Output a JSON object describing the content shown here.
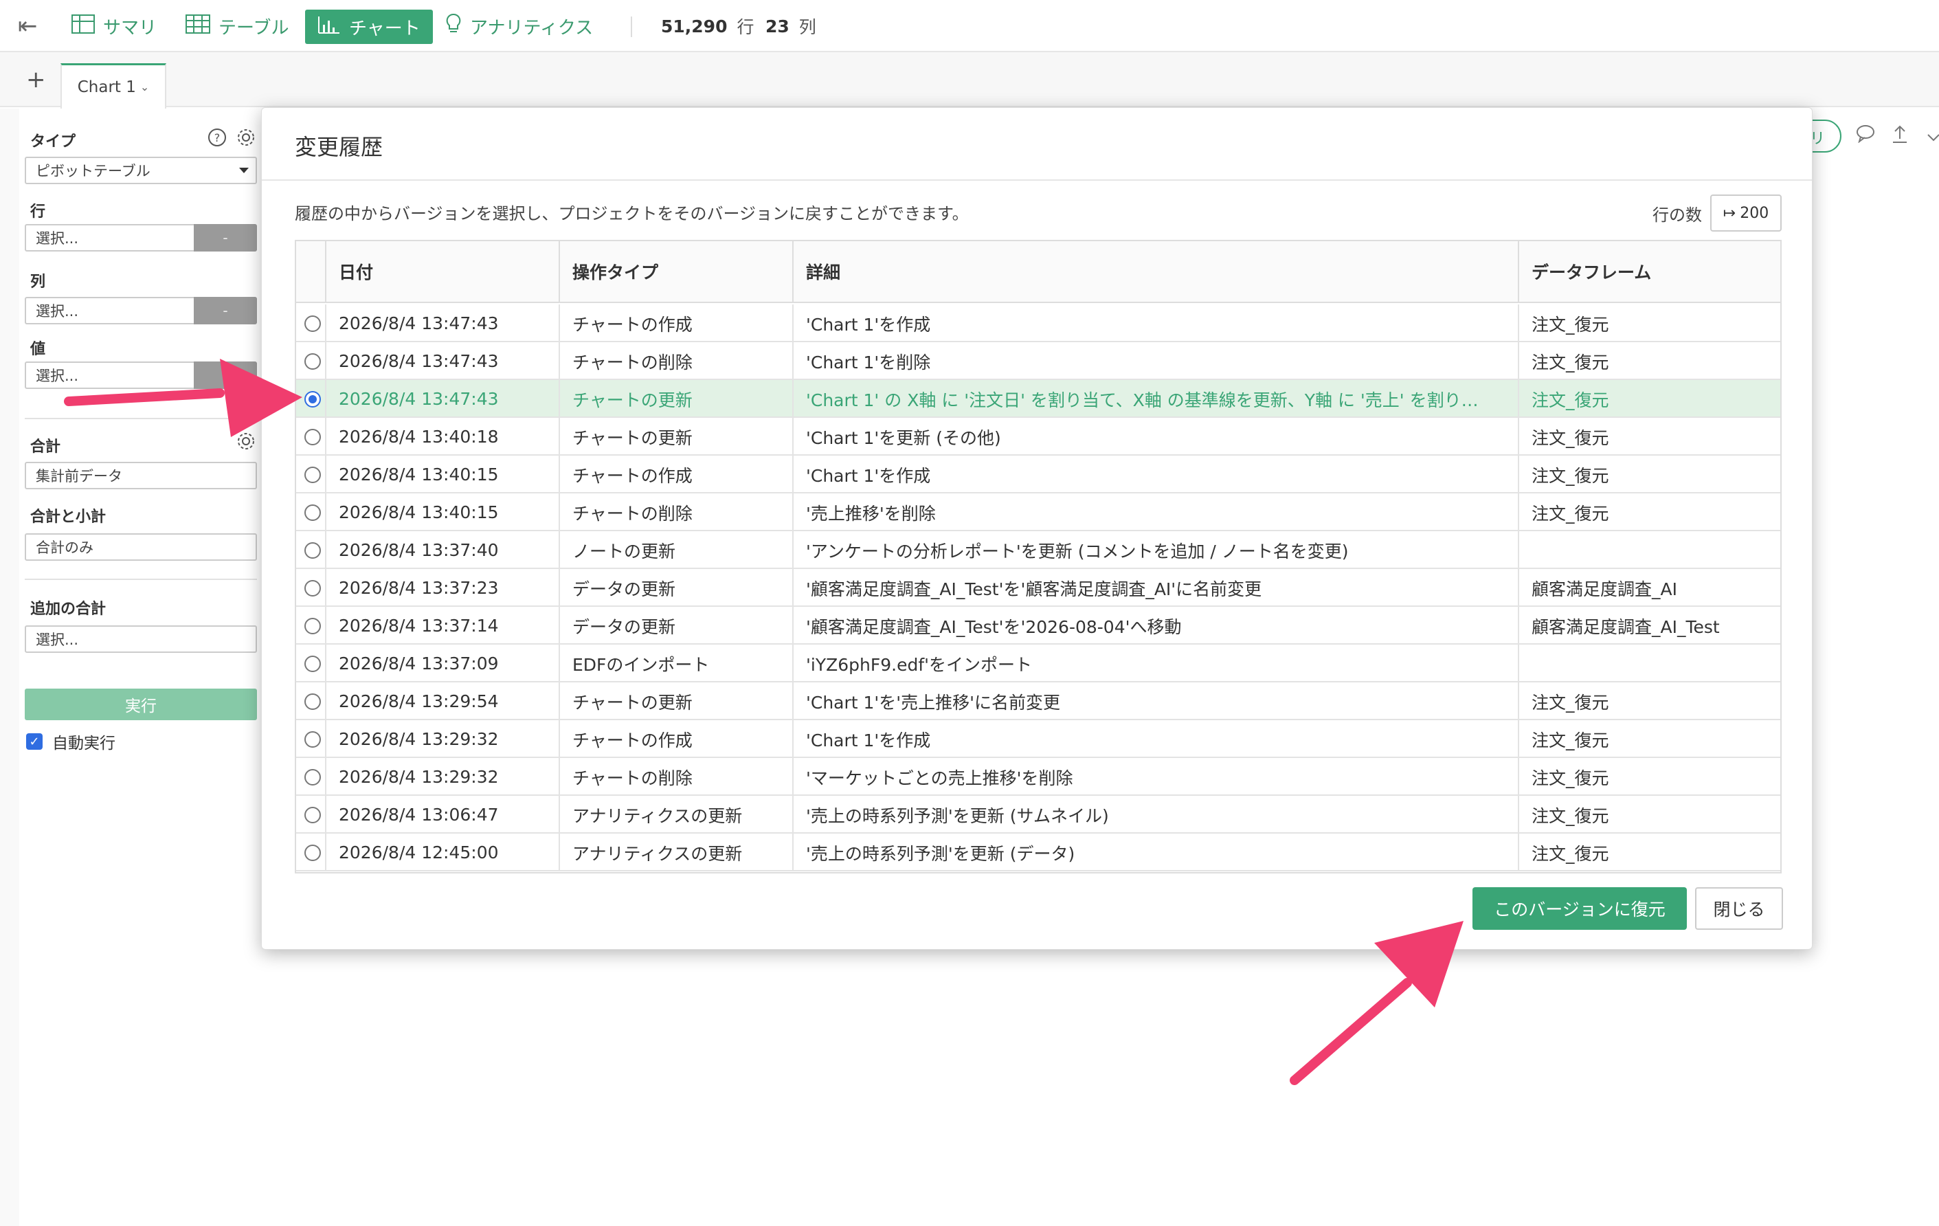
{
  "toolbar": {
    "back_icon": "collapse-left-icon",
    "summary": "サマリ",
    "table": "テーブル",
    "chart": "チャート",
    "analytics": "アナリティクス",
    "rows_count": "51,290",
    "rows_unit": "行",
    "cols_count": "23",
    "cols_unit": "列"
  },
  "tabs": {
    "add": "+",
    "active_tab": "Chart 1"
  },
  "sidebar": {
    "type_label": "タイプ",
    "type_value": "ピボットテーブル",
    "row_label": "行",
    "row_placeholder": "選択...",
    "col_label": "列",
    "col_placeholder": "選択...",
    "value_label": "値",
    "value_placeholder": "選択...",
    "minus": "-",
    "total_label": "合計",
    "total_value": "集計前データ",
    "subtotal_label": "合計と小計",
    "subtotal_value": "合計のみ",
    "extra_total_label": "追加の合計",
    "extra_total_placeholder": "選択...",
    "run_button": "実行",
    "auto_run_label": "自動実行",
    "auto_run_checked": true
  },
  "modal": {
    "title": "変更履歴",
    "description": "履歴の中からバージョンを選択し、プロジェクトをそのバージョンに戻すことができます。",
    "rows_label": "行の数",
    "rows_value": "200",
    "columns": [
      "日付",
      "操作タイプ",
      "詳細",
      "データフレーム"
    ],
    "rows": [
      {
        "date": "2026/8/4 13:47:43",
        "op": "チャートの作成",
        "detail": "'Chart 1'を作成",
        "df": "注文_復元",
        "selected": false
      },
      {
        "date": "2026/8/4 13:47:43",
        "op": "チャートの削除",
        "detail": "'Chart 1'を削除",
        "df": "注文_復元",
        "selected": false
      },
      {
        "date": "2026/8/4 13:47:43",
        "op": "チャートの更新",
        "detail": "'Chart 1' の X軸 に '注文日' を割り当て、X軸 の基準線を更新、Y軸 に '売上' を割り…",
        "df": "注文_復元",
        "selected": true
      },
      {
        "date": "2026/8/4 13:40:18",
        "op": "チャートの更新",
        "detail": "'Chart 1'を更新 (その他)",
        "df": "注文_復元",
        "selected": false
      },
      {
        "date": "2026/8/4 13:40:15",
        "op": "チャートの作成",
        "detail": "'Chart 1'を作成",
        "df": "注文_復元",
        "selected": false
      },
      {
        "date": "2026/8/4 13:40:15",
        "op": "チャートの削除",
        "detail": "'売上推移'を削除",
        "df": "注文_復元",
        "selected": false
      },
      {
        "date": "2026/8/4 13:37:40",
        "op": "ノートの更新",
        "detail": "'アンケートの分析レポート'を更新 (コメントを追加 / ノート名を変更)",
        "df": "",
        "selected": false
      },
      {
        "date": "2026/8/4 13:37:23",
        "op": "データの更新",
        "detail": "'顧客満足度調査_AI_Test'を'顧客満足度調査_AI'に名前変更",
        "df": "顧客満足度調査_AI",
        "selected": false
      },
      {
        "date": "2026/8/4 13:37:14",
        "op": "データの更新",
        "detail": "'顧客満足度調査_AI_Test'を'2026-08-04'へ移動",
        "df": "顧客満足度調査_AI_Test",
        "selected": false
      },
      {
        "date": "2026/8/4 13:37:09",
        "op": "EDFのインポート",
        "detail": "'iYZ6phF9.edf'をインポート",
        "df": "",
        "selected": false
      },
      {
        "date": "2026/8/4 13:29:54",
        "op": "チャートの更新",
        "detail": "'Chart 1'を'売上推移'に名前変更",
        "df": "注文_復元",
        "selected": false
      },
      {
        "date": "2026/8/4 13:29:32",
        "op": "チャートの作成",
        "detail": "'Chart 1'を作成",
        "df": "注文_復元",
        "selected": false
      },
      {
        "date": "2026/8/4 13:29:32",
        "op": "チャートの削除",
        "detail": "'マーケットごとの売上推移'を削除",
        "df": "注文_復元",
        "selected": false
      },
      {
        "date": "2026/8/4 13:06:47",
        "op": "アナリティクスの更新",
        "detail": "'売上の時系列予測'を更新 (サムネイル)",
        "df": "注文_復元",
        "selected": false
      },
      {
        "date": "2026/8/4 12:45:00",
        "op": "アナリティクスの更新",
        "detail": "'売上の時系列予測'を更新 (データ)",
        "df": "注文_復元",
        "selected": false
      }
    ],
    "restore_button": "このバージョンに復元",
    "close_button": "閉じる"
  },
  "right_toolbar": {
    "pill_text": "リ"
  },
  "colors": {
    "accent": "#3aa576",
    "annotation_arrow": "#f03d6e",
    "selected_row_bg": "#e2f2e5"
  }
}
